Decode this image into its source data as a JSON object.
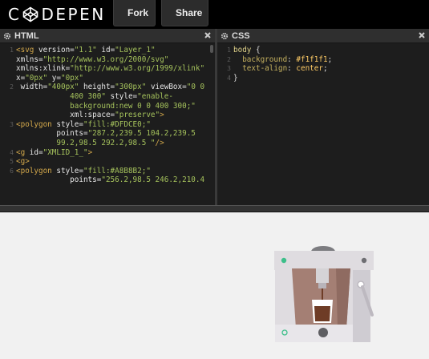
{
  "header": {
    "logo_text": "C DEPEN",
    "fork_label": "Fork",
    "share_label": "Share"
  },
  "html_panel": {
    "title": "HTML",
    "lines": [
      {
        "n": "1",
        "parts": [
          [
            "tag",
            "<svg "
          ],
          [
            "attr",
            "version="
          ],
          [
            "str",
            "\"1.1\""
          ],
          [
            "attr",
            " id="
          ],
          [
            "str",
            "\"Layer_1\""
          ]
        ]
      },
      {
        "n": "",
        "parts": [
          [
            "attr",
            "xmlns="
          ],
          [
            "str",
            "\"http://www.w3.org/2000/svg\""
          ]
        ]
      },
      {
        "n": "",
        "parts": [
          [
            "attr",
            "xmlns:xlink="
          ],
          [
            "str",
            "\"http://www.w3.org/1999/xlink\""
          ]
        ]
      },
      {
        "n": "",
        "parts": [
          [
            "attr",
            "x="
          ],
          [
            "str",
            "\"0px\""
          ],
          [
            "attr",
            " y="
          ],
          [
            "str",
            "\"0px\""
          ]
        ]
      },
      {
        "n": "2",
        "parts": [
          [
            "attr",
            " width="
          ],
          [
            "str",
            "\"400px\""
          ],
          [
            "attr",
            " height="
          ],
          [
            "str",
            "\"300px\""
          ],
          [
            "attr",
            " viewBox="
          ],
          [
            "str",
            "\"0 0"
          ]
        ]
      },
      {
        "n": "",
        "parts": [
          [
            "str",
            "            400 300\""
          ],
          [
            "attr",
            " style="
          ],
          [
            "str",
            "\"enable-"
          ]
        ]
      },
      {
        "n": "",
        "parts": [
          [
            "str",
            "            background:new 0 0 400 300;\""
          ]
        ]
      },
      {
        "n": "",
        "parts": [
          [
            "attr",
            "            xml:space="
          ],
          [
            "str",
            "\"preserve\""
          ],
          [
            "tag",
            ">"
          ]
        ]
      },
      {
        "n": "3",
        "parts": [
          [
            "tag",
            "<polygon "
          ],
          [
            "attr",
            "style="
          ],
          [
            "str",
            "\"fill:#DFDCE0;\""
          ]
        ]
      },
      {
        "n": "",
        "parts": [
          [
            "attr",
            "         points="
          ],
          [
            "str",
            "\"287.2,239.5 104.2,239.5"
          ]
        ]
      },
      {
        "n": "",
        "parts": [
          [
            "str",
            "         99.2,98.5 292.2,98.5 \""
          ],
          [
            "tag",
            "/>"
          ]
        ]
      },
      {
        "n": "4",
        "parts": [
          [
            "tag",
            "<g "
          ],
          [
            "attr",
            "id="
          ],
          [
            "str",
            "\"XMLID_1_\""
          ],
          [
            "tag",
            ">"
          ]
        ]
      },
      {
        "n": "5",
        "parts": [
          [
            "tag",
            "<g>"
          ]
        ]
      },
      {
        "n": "6",
        "parts": [
          [
            "tag",
            "<polygon "
          ],
          [
            "attr",
            "style="
          ],
          [
            "str",
            "\"fill:#A8B8B2;\""
          ]
        ]
      },
      {
        "n": "",
        "parts": [
          [
            "attr",
            "            points="
          ],
          [
            "str",
            "\"256.2,98.5 246.2,210.4"
          ]
        ]
      }
    ]
  },
  "css_panel": {
    "title": "CSS",
    "lines": [
      {
        "n": "1",
        "parts": [
          [
            "sel",
            "body "
          ],
          [
            "brace",
            "{"
          ]
        ]
      },
      {
        "n": "2",
        "parts": [
          [
            "prop",
            "  background"
          ],
          [
            "brace",
            ": "
          ],
          [
            "val",
            "#f1f1f1"
          ],
          [
            "brace",
            ";"
          ]
        ]
      },
      {
        "n": "3",
        "parts": [
          [
            "prop",
            "  text-align"
          ],
          [
            "brace",
            ": "
          ],
          [
            "val",
            "center"
          ],
          [
            "brace",
            ";"
          ]
        ]
      },
      {
        "n": "4",
        "parts": [
          [
            "brace",
            "}"
          ]
        ]
      }
    ]
  },
  "preview": {
    "colors": {
      "body": "#dfdce0",
      "body_dark": "#b8b4ba",
      "front": "#f4f2f5",
      "inner": "#a47f74",
      "pipe": "#d5d3d6",
      "cup": "#ffffff",
      "coffee": "#6e3c26",
      "top_knob": "#7c7c80",
      "green_light": "#3dbf8a",
      "handle": "#bdb9c0"
    }
  }
}
